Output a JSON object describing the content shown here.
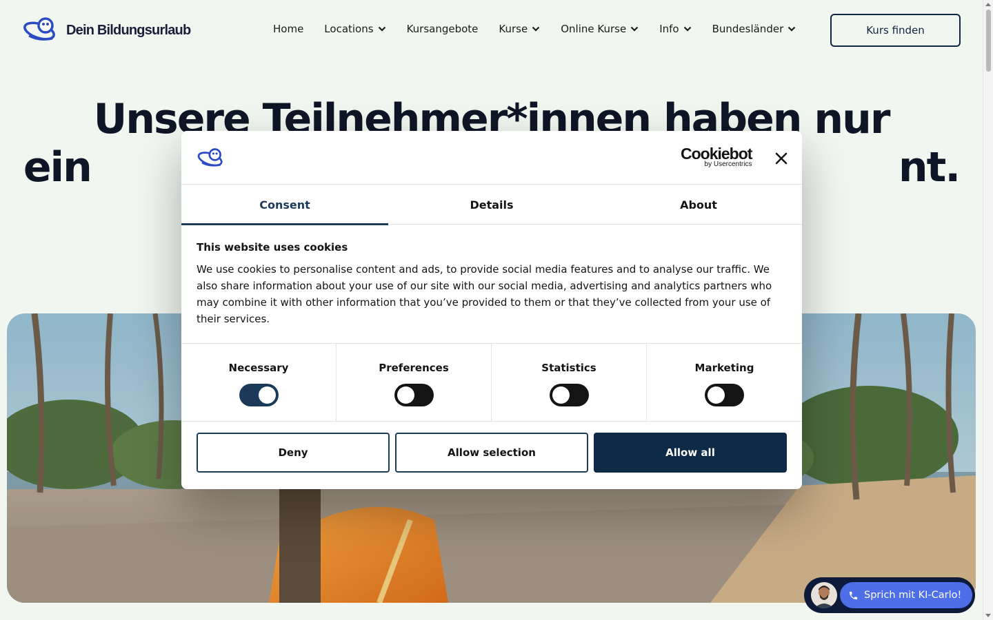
{
  "header": {
    "logo_text": "Dein Bildungsurlaub",
    "nav": [
      {
        "label": "Home",
        "dropdown": false
      },
      {
        "label": "Locations",
        "dropdown": true
      },
      {
        "label": "Kursangebote",
        "dropdown": false
      },
      {
        "label": "Kurse",
        "dropdown": true
      },
      {
        "label": "Online Kurse",
        "dropdown": true
      },
      {
        "label": "Info",
        "dropdown": true
      },
      {
        "label": "Bundesländer",
        "dropdown": true
      }
    ],
    "cta_label": "Kurs finden"
  },
  "hero": {
    "title_line1": "Unsere Teilnehmer*innen haben nur",
    "title_line2": "ein                                                              nt."
  },
  "cookie_dialog": {
    "brand": "Cookiebot",
    "brand_sub": "by Usercentrics",
    "tabs": [
      {
        "label": "Consent",
        "active": true
      },
      {
        "label": "Details",
        "active": false
      },
      {
        "label": "About",
        "active": false
      }
    ],
    "title": "This website uses cookies",
    "text": "We use cookies to personalise content and ads, to provide social media features and to analyse our traffic. We also share information about your use of our site with our social media, advertising and analytics partners who may combine it with other information that you’ve provided to them or that they’ve collected from your use of their services.",
    "toggles": [
      {
        "label": "Necessary",
        "on": true
      },
      {
        "label": "Preferences",
        "on": false
      },
      {
        "label": "Statistics",
        "on": false
      },
      {
        "label": "Marketing",
        "on": false
      }
    ],
    "buttons": {
      "deny": "Deny",
      "allow_selection": "Allow selection",
      "allow_all": "Allow all"
    }
  },
  "chat": {
    "label": "Sprich mit KI-Carlo!"
  },
  "colors": {
    "page_bg": "#f1f6f0",
    "navy": "#0d2a46",
    "accent_blue": "#1b3a5a",
    "logo_blue": "#2b4bc4",
    "chat_pill": "#4e6ee8"
  }
}
